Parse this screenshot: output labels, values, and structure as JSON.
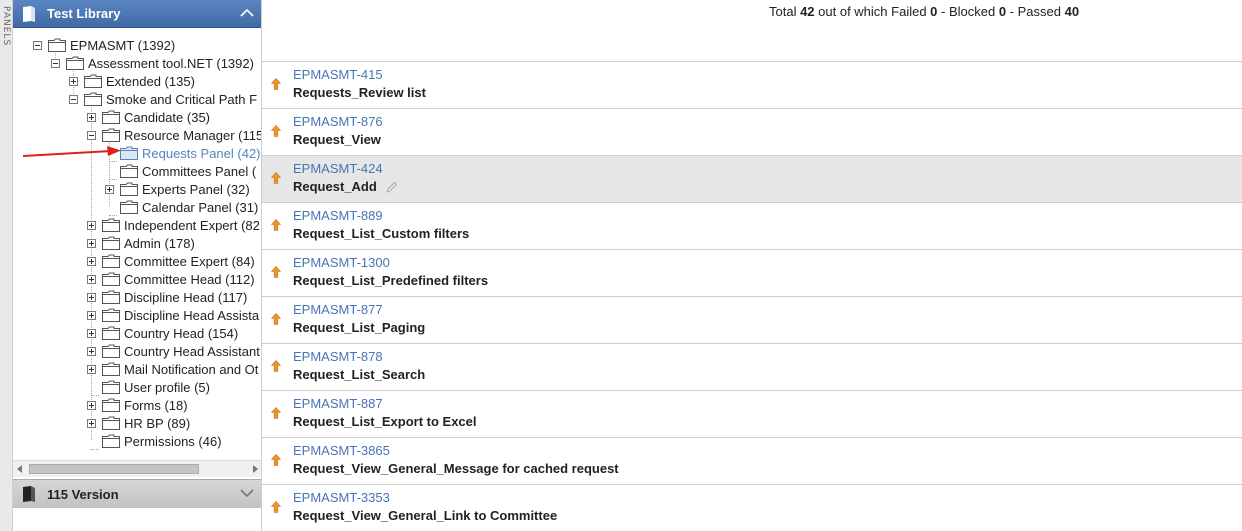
{
  "side_strip": {
    "label": "PANELS"
  },
  "library": {
    "title": "Test Library",
    "tree": [
      {
        "label": "EPMASMT (1392)",
        "level": 0,
        "expander": "minus"
      },
      {
        "label": "Assessment tool.NET (1392)",
        "level": 1,
        "expander": "minus"
      },
      {
        "label": "Extended (135)",
        "level": 2,
        "expander": "plus"
      },
      {
        "label": "Smoke and Critical Path F",
        "level": 2,
        "expander": "minus"
      },
      {
        "label": "Candidate (35)",
        "level": 3,
        "expander": "plus"
      },
      {
        "label": "Resource Manager (115",
        "level": 3,
        "expander": "minus"
      },
      {
        "label": "Requests Panel (42)",
        "level": 4,
        "expander": "none",
        "selected": true
      },
      {
        "label": "Committees Panel (",
        "level": 4,
        "expander": "none"
      },
      {
        "label": "Experts Panel (32)",
        "level": 4,
        "expander": "plus"
      },
      {
        "label": "Calendar Panel (31)",
        "level": 4,
        "expander": "none"
      },
      {
        "label": "Independent Expert (82",
        "level": 3,
        "expander": "plus"
      },
      {
        "label": "Admin (178)",
        "level": 3,
        "expander": "plus"
      },
      {
        "label": "Committee Expert (84)",
        "level": 3,
        "expander": "plus"
      },
      {
        "label": "Committee Head (112)",
        "level": 3,
        "expander": "plus"
      },
      {
        "label": "Discipline Head (117)",
        "level": 3,
        "expander": "plus"
      },
      {
        "label": "Discipline Head Assista",
        "level": 3,
        "expander": "plus"
      },
      {
        "label": "Country Head (154)",
        "level": 3,
        "expander": "plus"
      },
      {
        "label": "Country Head Assistant",
        "level": 3,
        "expander": "plus"
      },
      {
        "label": "Mail Notification and Ot",
        "level": 3,
        "expander": "plus"
      },
      {
        "label": "User profile (5)",
        "level": 3,
        "expander": "none"
      },
      {
        "label": "Forms (18)",
        "level": 3,
        "expander": "plus"
      },
      {
        "label": "HR BP (89)",
        "level": 3,
        "expander": "plus"
      },
      {
        "label": "Permissions (46)",
        "level": 3,
        "expander": "none"
      }
    ]
  },
  "version_panel": {
    "title": "115 Version"
  },
  "summary": {
    "prefix": "Total ",
    "total": "42",
    "mid1": " out of which Failed ",
    "failed": "0",
    "mid2": " - Blocked ",
    "blocked": "0",
    "mid3": " - Passed ",
    "passed": "40"
  },
  "test_cases": [
    {
      "id": "EPMASMT-415",
      "name": "Requests_Review list"
    },
    {
      "id": "EPMASMT-876",
      "name": "Request_View"
    },
    {
      "id": "EPMASMT-424",
      "name": "Request_Add",
      "highlighted": true,
      "editable": true
    },
    {
      "id": "EPMASMT-889",
      "name": "Request_List_Custom filters"
    },
    {
      "id": "EPMASMT-1300",
      "name": "Request_List_Predefined filters"
    },
    {
      "id": "EPMASMT-877",
      "name": "Request_List_Paging"
    },
    {
      "id": "EPMASMT-878",
      "name": "Request_List_Search"
    },
    {
      "id": "EPMASMT-887",
      "name": "Request_List_Export to Excel"
    },
    {
      "id": "EPMASMT-3865",
      "name": "Request_View_General_Message for cached request"
    },
    {
      "id": "EPMASMT-3353",
      "name": "Request_View_General_Link to Committee"
    }
  ],
  "colors": {
    "header_blue": "#4a76b3",
    "link_blue": "#4a73b5",
    "priority_orange": "#f0952a",
    "arrow_red": "#e02020",
    "row_highlight": "#e6e6e6"
  },
  "icons": {
    "library": "book-icon",
    "version": "book-icon",
    "collapse": "chevron-up-icon",
    "expand": "chevron-down-icon",
    "priority": "arrow-up-icon",
    "edit": "pencil-icon",
    "folder": "folder-icon"
  }
}
